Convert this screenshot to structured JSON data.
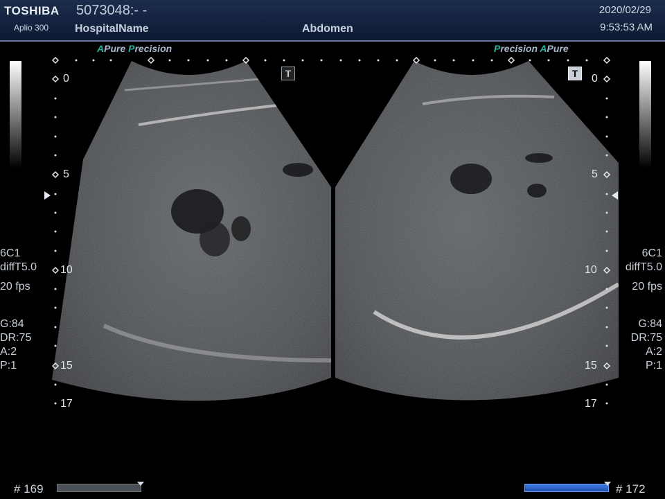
{
  "header": {
    "brand": "TOSHIBA",
    "model": "Aplio 300",
    "patient_id": "5073048:- -",
    "hospital": "HospitalName",
    "exam": "Abdomen",
    "date": "2020/02/29",
    "time": "9:53:53 AM"
  },
  "left_image": {
    "preset_a": "A",
    "preset_pure": "Pure",
    "preset_p": "P",
    "preset_recision": "recision",
    "depth_labels": [
      "0",
      "5",
      "10",
      "15",
      "17"
    ]
  },
  "right_image": {
    "preset_p": "P",
    "preset_recision": "recision",
    "preset_a": "A",
    "preset_pure": "Pure",
    "depth_labels": [
      "0",
      "5",
      "10",
      "15",
      "17"
    ]
  },
  "params": {
    "probe": "6C1",
    "mode": "diffT5.0",
    "fps": "20 fps",
    "gain": "G:84",
    "dr": "DR:75",
    "a": "A:2",
    "p": "P:1"
  },
  "cine": {
    "left_frame": "# 169",
    "right_frame": "# 172"
  }
}
